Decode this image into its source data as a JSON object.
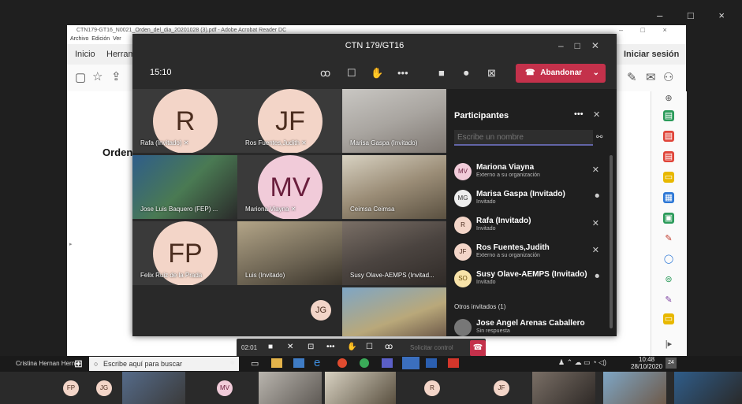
{
  "outer": {
    "controls": "– □ ×"
  },
  "acrobat": {
    "title": "CTN179-GT16_N0021_Orden_del_dia_20201028 (3).pdf - Adobe Acrobat Reader DC",
    "menu": [
      "Archivo",
      "Edición",
      "Ver"
    ],
    "tabs": [
      "Inicio",
      "Herrami"
    ],
    "signin": "Iniciar sesión",
    "doc_text": "Orden",
    "win_controls": "– □ ×"
  },
  "teams": {
    "title": "CTN 179/GT16",
    "time": "15:10",
    "leave_label": "Abandonar",
    "tiles": [
      {
        "name": "Rafa (Invitado)",
        "initials": "R"
      },
      {
        "name": "Ros Fuentes,Judith",
        "initials": "JF"
      },
      {
        "name": "Marisa Gaspa (Invitado)",
        "initials": ""
      },
      {
        "name": "Jose Luis Baquero (FEP) ...",
        "initials": ""
      },
      {
        "name": "Mariona Viayna",
        "initials": "MV"
      },
      {
        "name": "Ceimsa Ceimsa",
        "initials": ""
      },
      {
        "name": "Felix Ruiz de la Prada",
        "initials": "FP"
      },
      {
        "name": "Luis (Invitado)",
        "initials": ""
      },
      {
        "name": "Susy Olave-AEMPS (Invitad...",
        "initials": ""
      },
      {
        "name": "",
        "initials": "JG"
      }
    ],
    "panel": {
      "title": "Participantes",
      "search_placeholder": "Escribe un nombre",
      "participants": [
        {
          "initials": "MV",
          "name": "Mariona Viayna",
          "sub": "Externo a su organización"
        },
        {
          "initials": "MG",
          "name": "Marisa Gaspa (Invitado)",
          "sub": "Invitado"
        },
        {
          "initials": "R",
          "name": "Rafa (Invitado)",
          "sub": "Invitado"
        },
        {
          "initials": "JF",
          "name": "Ros Fuentes,Judith",
          "sub": "Externo a su organización"
        },
        {
          "initials": "SO",
          "name": "Susy Olave-AEMPS (Invitado)",
          "sub": "Invitado"
        }
      ],
      "others_header": "Otros invitados (1)",
      "others": [
        {
          "name": "Jose Angel Arenas Caballero",
          "sub": "Sin respuesta"
        }
      ]
    },
    "callbar": {
      "time": "02:01",
      "control": "Solicitar control"
    }
  },
  "taskbar": {
    "user": "Cristina Hernan Hernan",
    "search_placeholder": "Escribe aquí para buscar",
    "time": "10:48",
    "date": "28/10/2020",
    "badge": "24"
  },
  "strip": [
    "FP",
    "JG",
    "MV",
    "R",
    "JF"
  ]
}
